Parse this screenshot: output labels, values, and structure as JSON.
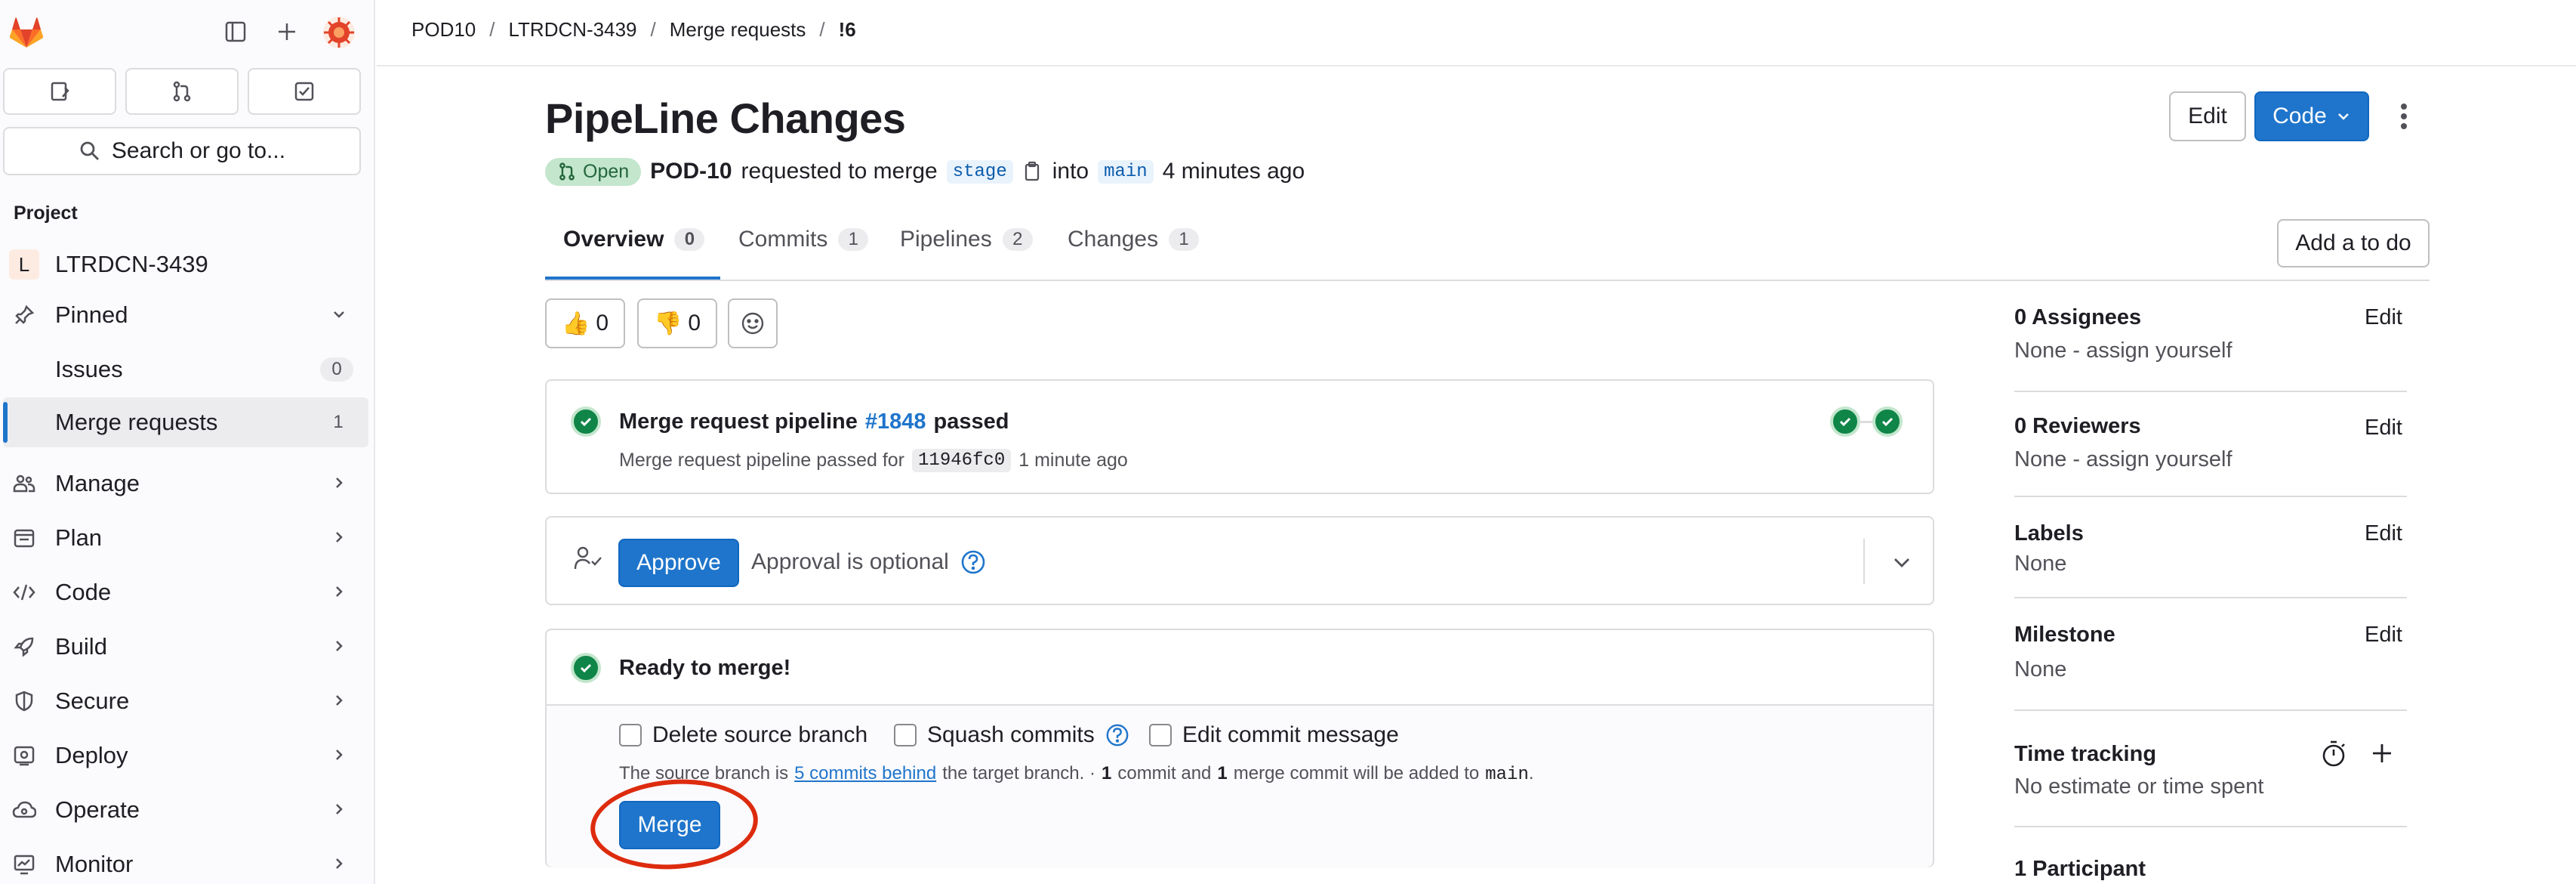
{
  "sidebar": {
    "section_title": "Project",
    "project": {
      "initial": "L",
      "name": "LTRDCN-3439"
    },
    "search_placeholder": "Search or go to...",
    "pinned_label": "Pinned",
    "pinned_items": [
      {
        "label": "Issues",
        "count": "0"
      },
      {
        "label": "Merge requests",
        "count": "1"
      }
    ],
    "nav_items": [
      {
        "label": "Manage",
        "icon": "users-icon"
      },
      {
        "label": "Plan",
        "icon": "plan-icon"
      },
      {
        "label": "Code",
        "icon": "code-icon"
      },
      {
        "label": "Build",
        "icon": "rocket-icon"
      },
      {
        "label": "Secure",
        "icon": "shield-icon"
      },
      {
        "label": "Deploy",
        "icon": "deploy-icon"
      },
      {
        "label": "Operate",
        "icon": "cloud-gear-icon"
      },
      {
        "label": "Monitor",
        "icon": "monitor-icon"
      }
    ]
  },
  "breadcrumb": [
    "POD10",
    "LTRDCN-3439",
    "Merge requests",
    "!6"
  ],
  "mr": {
    "title": "PipeLine Changes",
    "status": "Open",
    "author": "POD-10",
    "requested_text": "requested to merge",
    "source_branch": "stage",
    "into_text": "into",
    "target_branch": "main",
    "time_ago": "4 minutes ago",
    "edit_label": "Edit",
    "code_label": "Code",
    "add_todo_label": "Add a to do"
  },
  "tabs": [
    {
      "label": "Overview",
      "count": "0"
    },
    {
      "label": "Commits",
      "count": "1"
    },
    {
      "label": "Pipelines",
      "count": "2"
    },
    {
      "label": "Changes",
      "count": "1"
    }
  ],
  "reactions": {
    "thumbs_up": "0",
    "thumbs_down": "0"
  },
  "pipeline": {
    "prefix": "Merge request pipeline",
    "id": "#1848",
    "status": "passed",
    "detail_prefix": "Merge request pipeline passed for",
    "commit": "11946fc0",
    "detail_time": "1 minute ago"
  },
  "approval": {
    "button_label": "Approve",
    "text": "Approval is optional"
  },
  "merge": {
    "ready_text": "Ready to merge!",
    "options": [
      "Delete source branch",
      "Squash commits",
      "Edit commit message"
    ],
    "info_prefix": "The source branch is",
    "info_link": "5 commits behind",
    "info_mid": "the target branch. ·",
    "info_commit_count": "1",
    "info_commit_text": "commit and",
    "info_merge_count": "1",
    "info_merge_text": "merge commit will be added to",
    "info_target": "main",
    "info_end": ".",
    "button_label": "Merge"
  },
  "sidebar_right": {
    "assignees_title": "0 Assignees",
    "assignees_value": "None - assign yourself",
    "reviewers_title": "0 Reviewers",
    "reviewers_value": "None - assign yourself",
    "labels_title": "Labels",
    "labels_value": "None",
    "milestone_title": "Milestone",
    "milestone_value": "None",
    "time_title": "Time tracking",
    "time_value": "No estimate or time spent",
    "participants_title": "1 Participant",
    "edit_label": "Edit"
  },
  "colors": {
    "brand_orange": "#e24329",
    "primary_blue": "#1f75cb",
    "success_green": "#108548",
    "annotation_red": "#dd2b0e"
  }
}
